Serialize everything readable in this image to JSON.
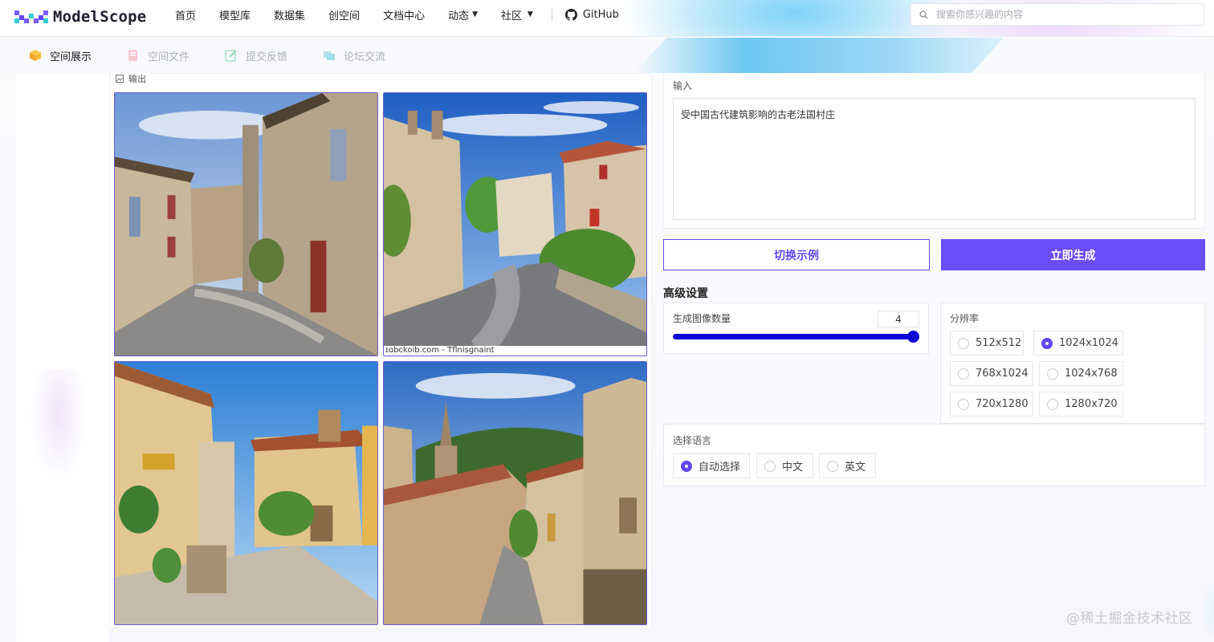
{
  "header": {
    "brand": "ModelScope",
    "nav": [
      {
        "label": "首页",
        "caret": false
      },
      {
        "label": "模型库",
        "caret": false
      },
      {
        "label": "数据集",
        "caret": false
      },
      {
        "label": "创空间",
        "caret": false
      },
      {
        "label": "文档中心",
        "caret": false
      },
      {
        "label": "动态",
        "caret": true
      },
      {
        "label": "社区",
        "caret": true
      }
    ],
    "github_label": "GitHub",
    "search_placeholder": "搜索你感兴趣的内容",
    "icons": {
      "search": "search-icon",
      "github": "github-icon",
      "caret": "chevron-down-icon"
    }
  },
  "tabs": [
    {
      "label": "空间展示",
      "active": true,
      "icon": "cube-icon"
    },
    {
      "label": "空间文件",
      "active": false,
      "icon": "file-icon"
    },
    {
      "label": "提交反馈",
      "active": false,
      "icon": "edit-icon"
    },
    {
      "label": "论坛交流",
      "active": false,
      "icon": "chat-icon"
    }
  ],
  "output": {
    "label": "输出",
    "icon": "image-icon",
    "image_caption_2": "ɪɑbckoib.com - Tflnisgnaint"
  },
  "input": {
    "label": "输入",
    "value": "受中国古代建筑影响的古老法国村庄"
  },
  "buttons": {
    "switch_example": "切换示例",
    "generate": "立即生成"
  },
  "advanced": {
    "title": "高级设置",
    "count_label": "生成图像数量",
    "count_value": "4",
    "count_fraction": 1.0,
    "resolution_label": "分辨率",
    "resolutions": [
      {
        "label": "512x512",
        "selected": false
      },
      {
        "label": "1024x1024",
        "selected": true
      },
      {
        "label": "768x1024",
        "selected": false
      },
      {
        "label": "1024x768",
        "selected": false
      },
      {
        "label": "720x1280",
        "selected": false
      },
      {
        "label": "1280x720",
        "selected": false
      }
    ],
    "language_label": "选择语言",
    "languages": [
      {
        "label": "自动选择",
        "selected": true
      },
      {
        "label": "中文",
        "selected": false
      },
      {
        "label": "英文",
        "selected": false
      }
    ]
  },
  "watermark": "@稀土掘金技术社区",
  "colors": {
    "accent": "#6b4ef7",
    "slider": "#0c04d8",
    "border": "#6b59c9"
  }
}
